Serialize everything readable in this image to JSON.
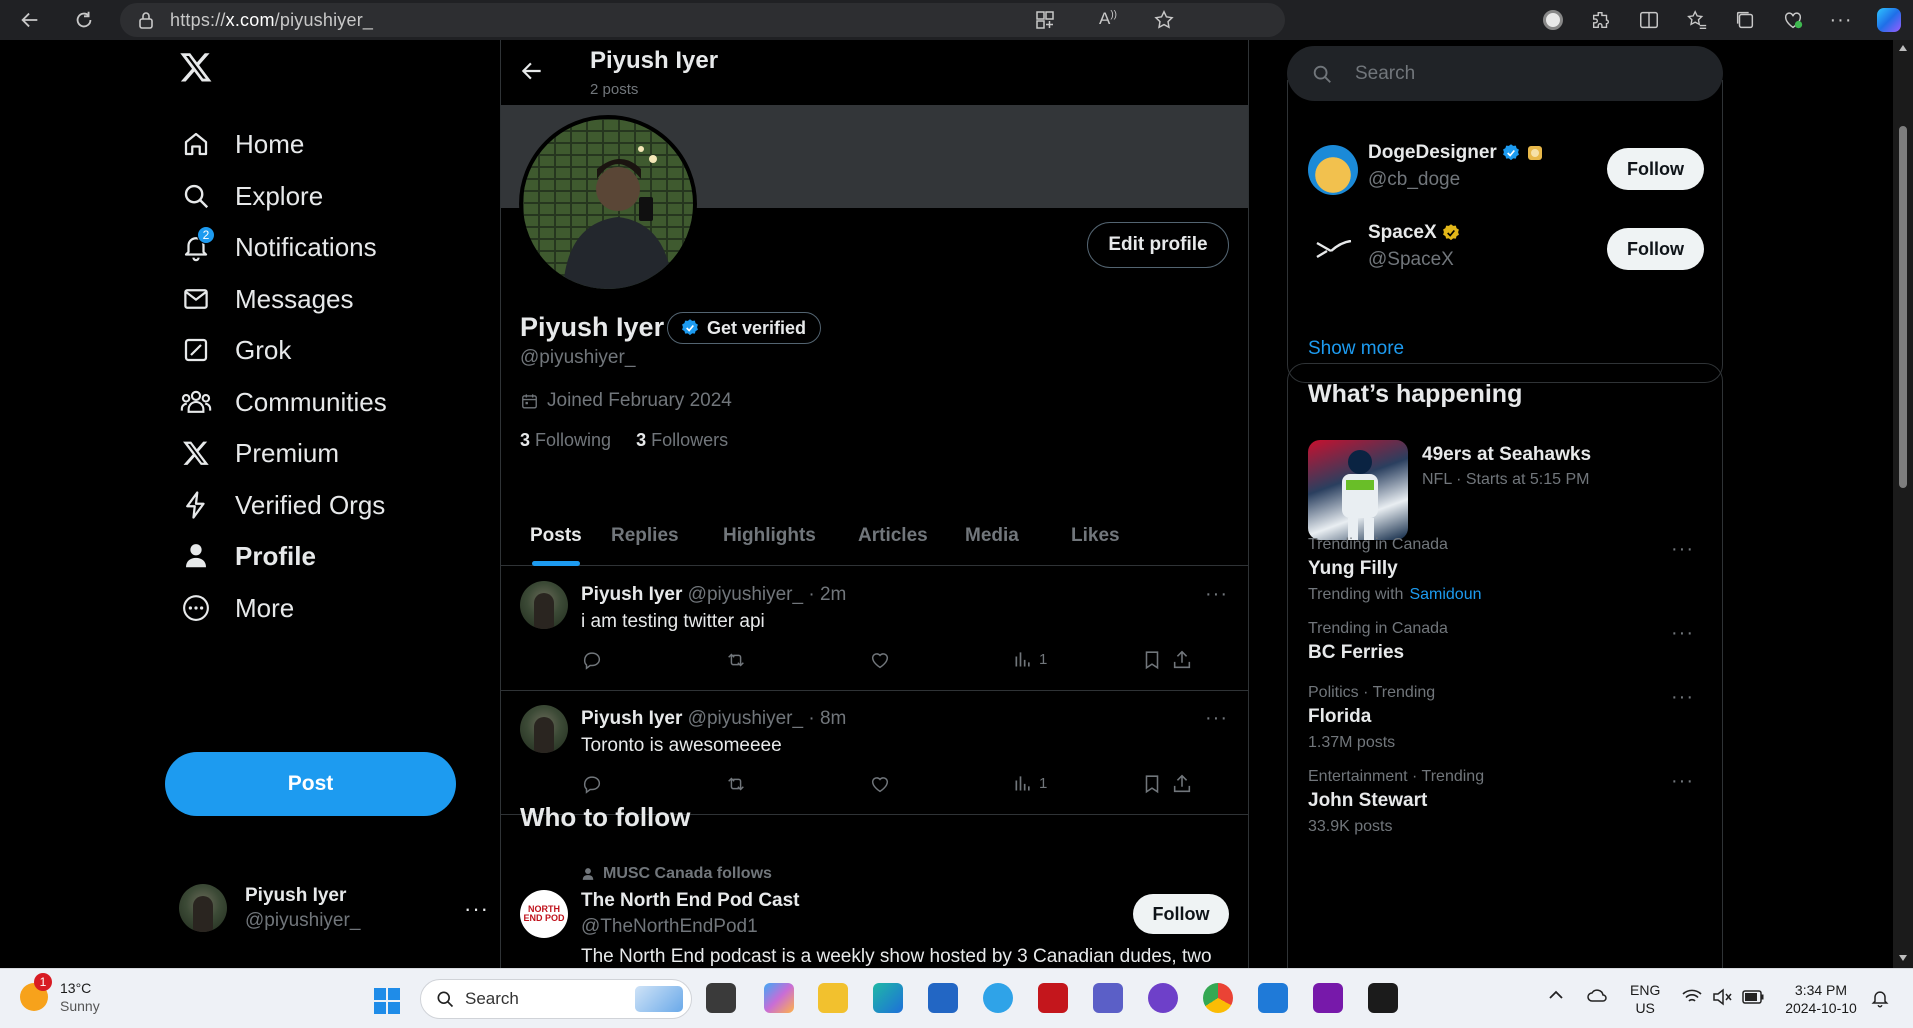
{
  "browser": {
    "url_prefix": "https://",
    "url_host": "x.com",
    "url_path": "/piyushiyer_"
  },
  "nav": {
    "items": [
      {
        "label": "Home",
        "icon": "home-icon"
      },
      {
        "label": "Explore",
        "icon": "search-icon"
      },
      {
        "label": "Notifications",
        "icon": "bell-icon",
        "badge": "2"
      },
      {
        "label": "Messages",
        "icon": "mail-icon"
      },
      {
        "label": "Grok",
        "icon": "grok-icon"
      },
      {
        "label": "Communities",
        "icon": "communities-icon"
      },
      {
        "label": "Premium",
        "icon": "x-logo-icon"
      },
      {
        "label": "Verified Orgs",
        "icon": "lightning-icon"
      },
      {
        "label": "Profile",
        "icon": "person-icon"
      },
      {
        "label": "More",
        "icon": "more-circle-icon"
      }
    ],
    "post_label": "Post"
  },
  "account": {
    "name": "Piyush Iyer",
    "handle": "@piyushiyer_",
    "more": "···"
  },
  "profile": {
    "header_name": "Piyush Iyer",
    "post_count": "2 posts",
    "edit_label": "Edit profile",
    "name": "Piyush Iyer",
    "get_verified": "Get verified",
    "handle": "@piyushiyer_",
    "joined": "Joined February 2024",
    "following_count": "3",
    "following_label": "Following",
    "followers_count": "3",
    "followers_label": "Followers"
  },
  "tabs": [
    "Posts",
    "Replies",
    "Highlights",
    "Articles",
    "Media",
    "Likes"
  ],
  "tweets": [
    {
      "name": "Piyush Iyer",
      "meta": "@piyushiyer_ · 2m",
      "text": "i am testing twitter api",
      "views": "1"
    },
    {
      "name": "Piyush Iyer",
      "meta": "@piyushiyer_ · 8m",
      "text": "Toronto is awesomeeee",
      "views": "1"
    }
  ],
  "who_to_follow": {
    "title": "Who to follow",
    "context": "MUSC Canada follows",
    "avatar_text": "NORTH END POD",
    "name": "The North End Pod Cast",
    "handle": "@TheNorthEndPod1",
    "bio": "The North End podcast is a weekly show hosted by 3 Canadian dudes, two",
    "follow_label": "Follow"
  },
  "search": {
    "placeholder": "Search"
  },
  "suggestions": [
    {
      "name": "DogeDesigner",
      "handle": "@cb_doge",
      "follow": "Follow",
      "verified_color": "#1d9bf0"
    },
    {
      "name": "SpaceX",
      "handle": "@SpaceX",
      "follow": "Follow",
      "verified_color": "#e2b719"
    }
  ],
  "show_more": "Show more",
  "happening": {
    "title": "What’s happening",
    "event_title": "49ers at Seahawks",
    "event_sub": "NFL · Starts at 5:15 PM",
    "trends": [
      {
        "context": "Trending in Canada",
        "name": "Yung Filly",
        "extra_prefix": "Trending with",
        "extra_link": "Samidoun"
      },
      {
        "context": "Trending in Canada",
        "name": "BC Ferries"
      },
      {
        "context": "Politics · Trending",
        "name": "Florida",
        "extra": "1.37M posts"
      },
      {
        "context": "Entertainment · Trending",
        "name": "John Stewart",
        "extra": "33.9K posts"
      }
    ]
  },
  "taskbar": {
    "weather_temp": "13°C",
    "weather_desc": "Sunny",
    "weather_badge": "1",
    "search_label": "Search",
    "lang1": "ENG",
    "lang2": "US",
    "time": "3:34 PM",
    "date": "2024-10-10"
  },
  "colors": {
    "accent": "#1d9bf0",
    "bg": "#000000",
    "border": "#2f3336",
    "muted": "#71767b"
  }
}
